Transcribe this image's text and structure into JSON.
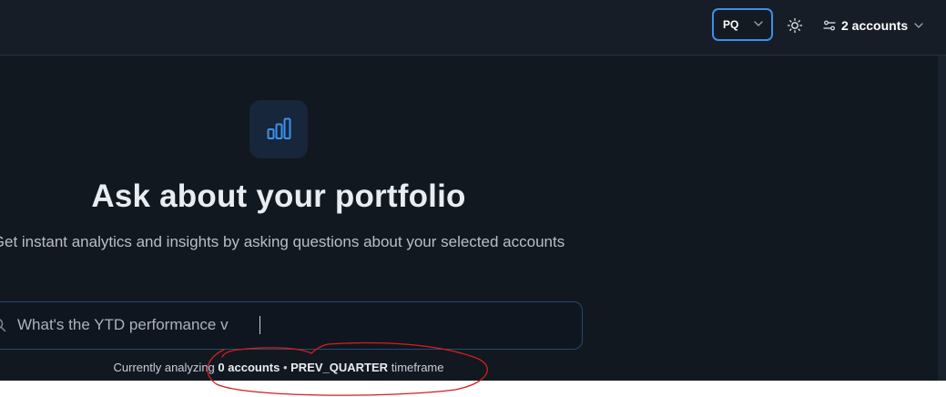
{
  "header": {
    "timeframe_select": {
      "value": "PQ"
    },
    "theme_toggle": {
      "icon": "sun-icon"
    },
    "accounts_button": {
      "label": "2 accounts",
      "icon": "sliders-icon"
    }
  },
  "hero": {
    "icon": "bar-chart-icon",
    "title": "Ask about your portfolio",
    "subtitle": "Get instant analytics and insights by asking questions about your selected accounts"
  },
  "search": {
    "icon": "search-icon",
    "value": "What's the YTD performance v"
  },
  "status": {
    "prefix": "Currently analyzing",
    "accounts": "0 accounts",
    "separator": "•",
    "timeframe": "PREV_QUARTER",
    "suffix": "timeframe"
  },
  "colors": {
    "background": "#111820",
    "topbar": "#161d26",
    "accent": "#3b8fe8",
    "annotation": "#d81e1e"
  }
}
